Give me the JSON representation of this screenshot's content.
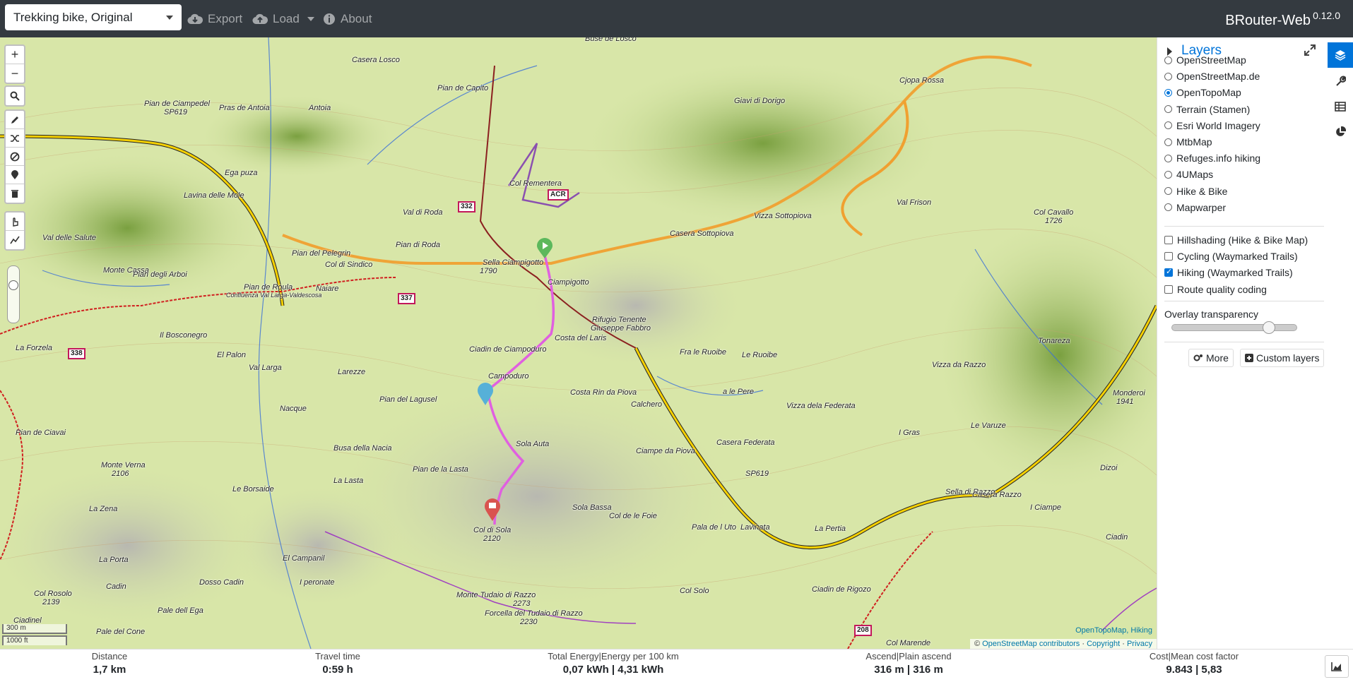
{
  "navbar": {
    "profile": "Trekking bike, Original",
    "export_label": "Export",
    "load_label": "Load",
    "about_label": "About",
    "brand": "BRouter-Web",
    "version": "0.12.0"
  },
  "map": {
    "zoom_in": "+",
    "zoom_out": "−",
    "labels": {
      "casera_losco": "Casera Losco",
      "buse_de_losco": "Buse de Losco",
      "pian_de_capito": "Pian de Capito",
      "pian_de_ciampedel": "Pian de Ciampedel",
      "pras_de_antoia": "Pras de Antoia",
      "antoia": "Antoia",
      "giavi_di_dorigo": "Giavi di Dorigo",
      "cjopa_rossa": "Cjopa Rossa",
      "ega_puza": "Ega puza",
      "lavina_delle_mole": "Lavina delle Mole",
      "col_rementera": "Col Rementera",
      "val_di_roda": "Val di Roda",
      "pian_di_roda": "Pian di Roda",
      "val_delle_salute": "Val delle Salute",
      "pian_del_pelegrin": "Pian del Pelegrin",
      "col_di_sindico": "Col di Sindico",
      "sella_ciampigotto": "Sella Ciampigotto",
      "sella_alt": "1790",
      "ciampigotto": "Ciampigotto",
      "casera_sottopiova": "Casera Sottopiova",
      "vizza_sottopiova": "Vizza Sottopiova",
      "val_frison": "Val Frison",
      "col_cavallo": "Col Cavallo",
      "col_cavallo_alt": "1726",
      "monte_cassa": "Monte Cassa",
      "pian_degli_arboi": "Pian degli Arboi",
      "pian_de_roula": "Pian de Roula",
      "confluenza": "Confluenza Val Larga-Valdescosa",
      "naiare": "Naiare",
      "rifugio": "Rifugio Tenente",
      "rifugio2": "Giuseppe Fabbro",
      "il_bosconegro": "Il Bosconegro",
      "la_forzela": "La Forzela",
      "el_palon": "El Palon",
      "val_larga": "Val Larga",
      "larezze": "Larezze",
      "ciadin_de_ciampoduro": "Ciadin de Ciampoduro",
      "costa_del_laris": "Costa del Laris",
      "fra_le_ruoibe": "Fra le Ruoibe",
      "le_ruoibe": "Le Ruoibe",
      "tonareza": "Tonareza",
      "vizza_da_razzo": "Vizza da Razzo",
      "campoduro": "Campoduro",
      "pian_del_lagusel": "Pian del Lagusel",
      "costa_rin_da_piova": "Costa Rin da Piova",
      "calchero": "Calchero",
      "a_le_pere": "a le Pere",
      "vizza_dela_federata": "Vizza dela Federata",
      "monderoi": "Monderoi",
      "monderoi_alt": "1941",
      "nacque": "Nacque",
      "pian_de_ciavai": "Pian de Ciavai",
      "busa_della_nacia": "Busa della Nacia",
      "sola_auta": "Sola Auta",
      "ciampe_da_piova": "Ciampe da Piova",
      "casera_federata": "Casera Federata",
      "i_gras": "I Gras",
      "le_varuze": "Le Varuze",
      "dizoi": "Dizoi",
      "monte_verna": "Monte Verna",
      "monte_verna_alt": "2106",
      "la_lasta": "La Lasta",
      "pian_de_la_lasta": "Pian de la Lasta",
      "le_borsaide": "Le Borsaide",
      "sella_di_razzo": "Sella di Razzo",
      "casera_razzo": "Casera Razzo",
      "i_ciampe": "I Ciampe",
      "la_zena": "La Zena",
      "col_di_sola": "Col di Sola",
      "col_di_sola_alt": "2120",
      "sola_bassa": "Sola Bassa",
      "col_de_le_foie": "Col de le Foie",
      "pala_de_l_uto": "Pala de l Uto",
      "lavinata": "Lavinata",
      "la_pertia": "La Pertia",
      "ciadin": "Ciadin",
      "el_campanil": "El Campanil",
      "la_porta": "La Porta",
      "dosso_cadin": "Dosso Cadin",
      "i_peronate": "I peronate",
      "col_solo": "Col Solo",
      "ciadin_de_rigozo": "Ciadin de Rigozo",
      "col_rosolo": "Col Rosolo",
      "col_rosolo_alt": "2139",
      "cadin": "Cadin",
      "pale_dell_ega": "Pale dell Ega",
      "monte_tudaio": "Monte Tudaio di Razzo",
      "monte_tudaio_alt": "2273",
      "forcella": "Forcella del Tudaio di Razzo",
      "forcella_alt": "2230",
      "ciadinel": "Ciadinel",
      "pale_del_cone": "Pale del Cone",
      "col_marende": "Col Marende",
      "sp619": "SP619",
      "sp619b": "SP619"
    },
    "shields": {
      "s332": "332",
      "s337": "337",
      "s338": "338",
      "acr": "ACR",
      "s208": "208"
    },
    "scale_m": "300 m",
    "scale_ft": "1000 ft",
    "attr_top_a": "OpenTopoMap",
    "attr_top_sep": ", ",
    "attr_top_b": "Hiking",
    "attr_copy": "©",
    "attr_osm": "OpenStreetMap contributors",
    "attr_copyright": "Copyright",
    "attr_privacy": "Privacy",
    "colors": {
      "route": "#e060e0",
      "hiking": "#f0a030",
      "road": "#f5d000"
    }
  },
  "sidebar": {
    "title": "Layers",
    "base_layers": [
      {
        "label": "OpenStreetMap",
        "checked": false
      },
      {
        "label": "OpenStreetMap.de",
        "checked": false
      },
      {
        "label": "OpenTopoMap",
        "checked": true
      },
      {
        "label": "Terrain (Stamen)",
        "checked": false
      },
      {
        "label": "Esri World Imagery",
        "checked": false
      },
      {
        "label": "MtbMap",
        "checked": false
      },
      {
        "label": "Refuges.info hiking",
        "checked": false
      },
      {
        "label": "4UMaps",
        "checked": false
      },
      {
        "label": "Hike & Bike",
        "checked": false
      },
      {
        "label": "Mapwarper",
        "checked": false
      }
    ],
    "overlays": [
      {
        "label": "Hillshading (Hike & Bike Map)",
        "checked": false
      },
      {
        "label": "Cycling (Waymarked Trails)",
        "checked": false
      },
      {
        "label": "Hiking (Waymarked Trails)",
        "checked": true
      },
      {
        "label": "Route quality coding",
        "checked": false
      }
    ],
    "overlay_transparency_label": "Overlay transparency",
    "overlay_transparency_value": 0.8,
    "more_label": "More",
    "custom_layers_label": "Custom layers"
  },
  "footer": {
    "distance_label": "Distance",
    "distance_value": "1,7 km",
    "travel_label": "Travel time",
    "travel_value": "0:59 h",
    "energy_label": "Total Energy|Energy per 100 km",
    "energy_value": "0,07 kWh | 4,31 kWh",
    "ascend_label": "Ascend|Plain ascend",
    "ascend_value": "316 m | 316 m",
    "cost_label": "Cost|Mean cost factor",
    "cost_value": "9.843 | 5,83"
  }
}
